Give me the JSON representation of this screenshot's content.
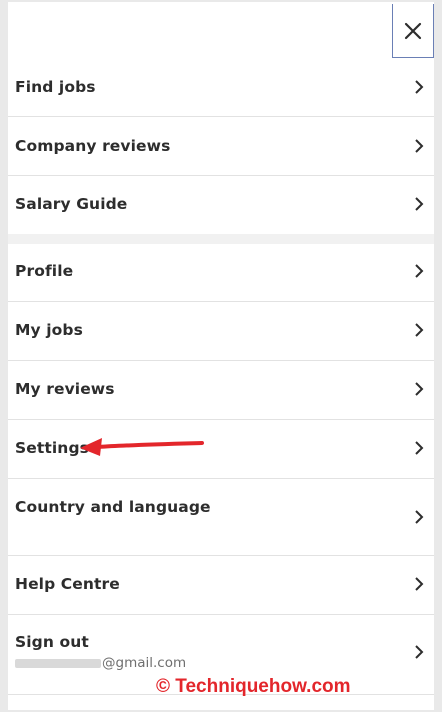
{
  "menu": {
    "close_icon": "close-icon",
    "chevron_icon": "chevron-right-icon",
    "group1": [
      {
        "label": "Find jobs"
      },
      {
        "label": "Company reviews"
      },
      {
        "label": "Salary Guide"
      }
    ],
    "group2": [
      {
        "label": "Profile"
      },
      {
        "label": "My jobs"
      },
      {
        "label": "My reviews"
      },
      {
        "label": "Settings"
      },
      {
        "label": "Country and language"
      },
      {
        "label": "Help Centre"
      },
      {
        "label": "Sign out",
        "email": "@gmail.com"
      }
    ]
  },
  "annotation": {
    "arrow_color": "#e3262b",
    "watermark": "© Techniquehow.com"
  },
  "colors": {
    "text": "#2d2d2d",
    "divider": "#e2e2e2",
    "close_border": "#6a7fb5"
  }
}
